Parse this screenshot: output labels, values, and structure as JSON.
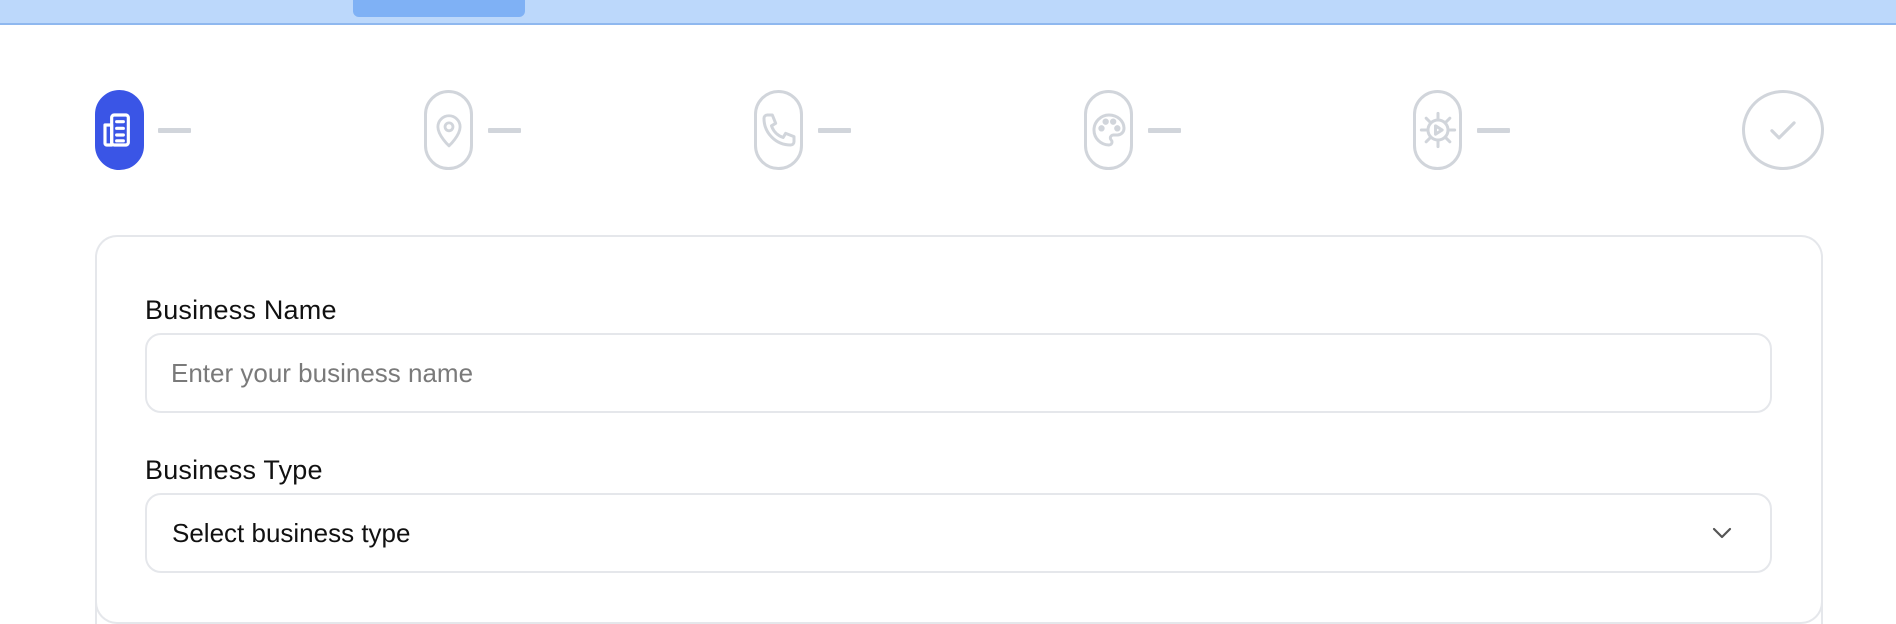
{
  "colors": {
    "accent": "#3a55e6",
    "inactive": "#d1d5db",
    "border": "#e5e7eb",
    "topbar": "#bcd8fb"
  },
  "stepper": {
    "steps": [
      {
        "icon": "building-icon",
        "state": "active"
      },
      {
        "icon": "map-pin-icon",
        "state": "inactive"
      },
      {
        "icon": "phone-icon",
        "state": "inactive"
      },
      {
        "icon": "palette-icon",
        "state": "inactive"
      },
      {
        "icon": "settings-play-icon",
        "state": "inactive"
      },
      {
        "icon": "check-icon",
        "state": "inactive"
      }
    ]
  },
  "form": {
    "business_name": {
      "label": "Business Name",
      "placeholder": "Enter your business name",
      "value": ""
    },
    "business_type": {
      "label": "Business Type",
      "selected": "Select business type",
      "icon": "chevron-down-icon"
    }
  }
}
